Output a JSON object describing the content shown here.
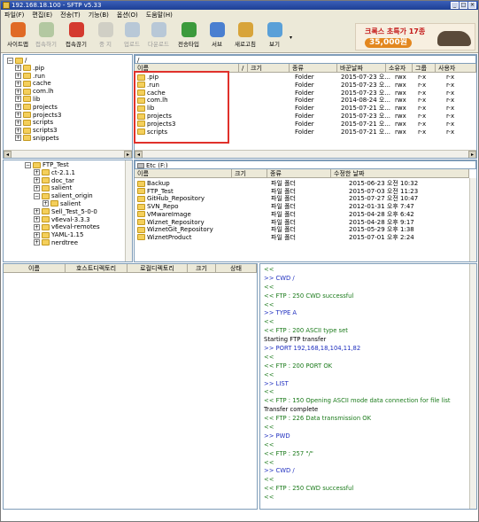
{
  "window": {
    "title": "192.168.18.100 - SFTP v5.33",
    "controls": [
      "_",
      "□",
      "×"
    ]
  },
  "menu": [
    "파일(F)",
    "편집(E)",
    "전송(T)",
    "기능(B)",
    "옵션(O)",
    "도움말(H)"
  ],
  "toolbar": [
    {
      "label": "사이트맵",
      "color": "#e06a25",
      "enabled": true
    },
    {
      "label": "접속하기",
      "color": "#6fa05f",
      "enabled": false
    },
    {
      "label": "접속끊기",
      "color": "#d43a2f",
      "enabled": true
    },
    {
      "label": "중 지",
      "color": "#b0b0b0",
      "enabled": false
    },
    {
      "label": "업로드",
      "color": "#7aa0d8",
      "enabled": false
    },
    {
      "label": "다운로드",
      "color": "#7aa0d8",
      "enabled": false
    },
    {
      "label": "전송타입",
      "color": "#3c9a3c",
      "enabled": true
    },
    {
      "label": "서브",
      "color": "#4a7fd0",
      "enabled": true
    },
    {
      "label": "새로고침",
      "color": "#d8a43a",
      "enabled": true
    },
    {
      "label": "보기",
      "color": "#5aa0d8",
      "enabled": true
    }
  ],
  "ad": {
    "line1": "크록스 초특가 17종",
    "price": "35,000원"
  },
  "local_tree": {
    "root": "/",
    "items": [
      ".pip",
      ".run",
      "cache",
      "com.lh",
      "lib",
      "projects",
      "projects3",
      "scripts",
      "scripts3",
      "snippets"
    ]
  },
  "remote": {
    "path": "/",
    "columns": [
      "이름",
      "/",
      "크기",
      "종류",
      "바꾼날짜",
      "소유자",
      "그룹",
      "사용자"
    ],
    "rows": [
      {
        "name": ".pip",
        "type": "Folder",
        "date": "2015-07-23 오...",
        "owner": "rwx",
        "group": "r-x",
        "perm": "r-x"
      },
      {
        "name": ".run",
        "type": "Folder",
        "date": "2015-07-23 오...",
        "owner": "rwx",
        "group": "r-x",
        "perm": "r-x"
      },
      {
        "name": "cache",
        "type": "Folder",
        "date": "2015-07-23 오...",
        "owner": "rwx",
        "group": "r-x",
        "perm": "r-x"
      },
      {
        "name": "com.lh",
        "type": "Folder",
        "date": "2014-08-24 오...",
        "owner": "rwx",
        "group": "r-x",
        "perm": "r-x"
      },
      {
        "name": "lib",
        "type": "Folder",
        "date": "2015-07-21 오...",
        "owner": "rwx",
        "group": "r-x",
        "perm": "r-x"
      },
      {
        "name": "projects",
        "type": "Folder",
        "date": "2015-07-23 오...",
        "owner": "rwx",
        "group": "r-x",
        "perm": "r-x"
      },
      {
        "name": "projects3",
        "type": "Folder",
        "date": "2015-07-21 오...",
        "owner": "rwx",
        "group": "r-x",
        "perm": "r-x"
      },
      {
        "name": "scripts",
        "type": "Folder",
        "date": "2015-07-21 오...",
        "owner": "rwx",
        "group": "r-x",
        "perm": "r-x"
      }
    ]
  },
  "local_dir_tree": {
    "items": [
      {
        "label": "FTP_Test",
        "depth": 0,
        "sign": "−"
      },
      {
        "label": "ct-2.1.1",
        "depth": 1,
        "sign": "+"
      },
      {
        "label": "doc_tar",
        "depth": 1,
        "sign": "+"
      },
      {
        "label": "salient",
        "depth": 1,
        "sign": "+"
      },
      {
        "label": "salient_origin",
        "depth": 1,
        "sign": "−"
      },
      {
        "label": "salient",
        "depth": 2,
        "sign": "+"
      },
      {
        "label": "Sell_Test_5-0-0",
        "depth": 1,
        "sign": "+"
      },
      {
        "label": "v6eval-3.3.3",
        "depth": 1,
        "sign": "+"
      },
      {
        "label": "v6eval-remotes",
        "depth": 1,
        "sign": "+"
      },
      {
        "label": "YAML-1.15",
        "depth": 1,
        "sign": "+"
      },
      {
        "label": "nerdtree",
        "depth": 1,
        "sign": "+"
      }
    ]
  },
  "local": {
    "drive": "Etc (F:)",
    "columns": [
      "이름",
      "크기",
      "종류",
      "수정한 날짜"
    ],
    "rows": [
      {
        "name": "Backup",
        "type": "파일 폴더",
        "date": "2015-06-23 오전 10:32"
      },
      {
        "name": "FTP_Test",
        "type": "파일 폴더",
        "date": "2015-07-03 오전 11:23"
      },
      {
        "name": "GitHub_Repository",
        "type": "파일 폴더",
        "date": "2015-07-27 오전 10:47"
      },
      {
        "name": "SVN_Repo",
        "type": "파일 폴더",
        "date": "2012-01-31 오후 7:47"
      },
      {
        "name": "VMwareImage",
        "type": "파일 폴더",
        "date": "2015-04-28 오후 6:42"
      },
      {
        "name": "Wiznet_Repository",
        "type": "파일 폴더",
        "date": "2015-04-28 오후 9:17"
      },
      {
        "name": "WiznetGit_Repository",
        "type": "파일 폴더",
        "date": "2015-05-29 오후 1:38"
      },
      {
        "name": "WiznetProduct",
        "type": "파일 폴더",
        "date": "2015-07-01 오후 2:24"
      }
    ]
  },
  "queue": {
    "columns": [
      "이름",
      "호스트디렉토리",
      "로컬디렉토리",
      "크기",
      "상태"
    ]
  },
  "log": [
    {
      "text": "<<",
      "kind": "resp"
    },
    {
      "text": ">> CWD /",
      "kind": "cmd"
    },
    {
      "text": "<<",
      "kind": "resp"
    },
    {
      "text": "<< FTP : 250 CWD successful",
      "kind": "resp"
    },
    {
      "text": "<<",
      "kind": "resp"
    },
    {
      "text": ">> TYPE A",
      "kind": "cmd"
    },
    {
      "text": "<<",
      "kind": "resp"
    },
    {
      "text": "<< FTP : 200 ASCII type set",
      "kind": "resp"
    },
    {
      "text": "Starting FTP transfer",
      "kind": "plain"
    },
    {
      "text": ">> PORT 192,168,18,104,11,82",
      "kind": "cmd"
    },
    {
      "text": "<<",
      "kind": "resp"
    },
    {
      "text": "<< FTP : 200 PORT OK",
      "kind": "resp"
    },
    {
      "text": "<<",
      "kind": "resp"
    },
    {
      "text": ">> LIST",
      "kind": "cmd"
    },
    {
      "text": "<<",
      "kind": "resp"
    },
    {
      "text": "<< FTP : 150 Opening ASCII mode data connection for file list",
      "kind": "resp"
    },
    {
      "text": "Transfer complete",
      "kind": "plain"
    },
    {
      "text": "<< FTP : 226 Data transmission OK",
      "kind": "resp"
    },
    {
      "text": "<<",
      "kind": "resp"
    },
    {
      "text": ">> PWD",
      "kind": "cmd"
    },
    {
      "text": "<<",
      "kind": "resp"
    },
    {
      "text": "<< FTP : 257 \"/\"",
      "kind": "resp"
    },
    {
      "text": "<<",
      "kind": "resp"
    },
    {
      "text": ">> CWD /",
      "kind": "cmd"
    },
    {
      "text": "<<",
      "kind": "resp"
    },
    {
      "text": "<< FTP : 250 CWD successful",
      "kind": "resp"
    },
    {
      "text": "<<",
      "kind": "resp"
    }
  ]
}
